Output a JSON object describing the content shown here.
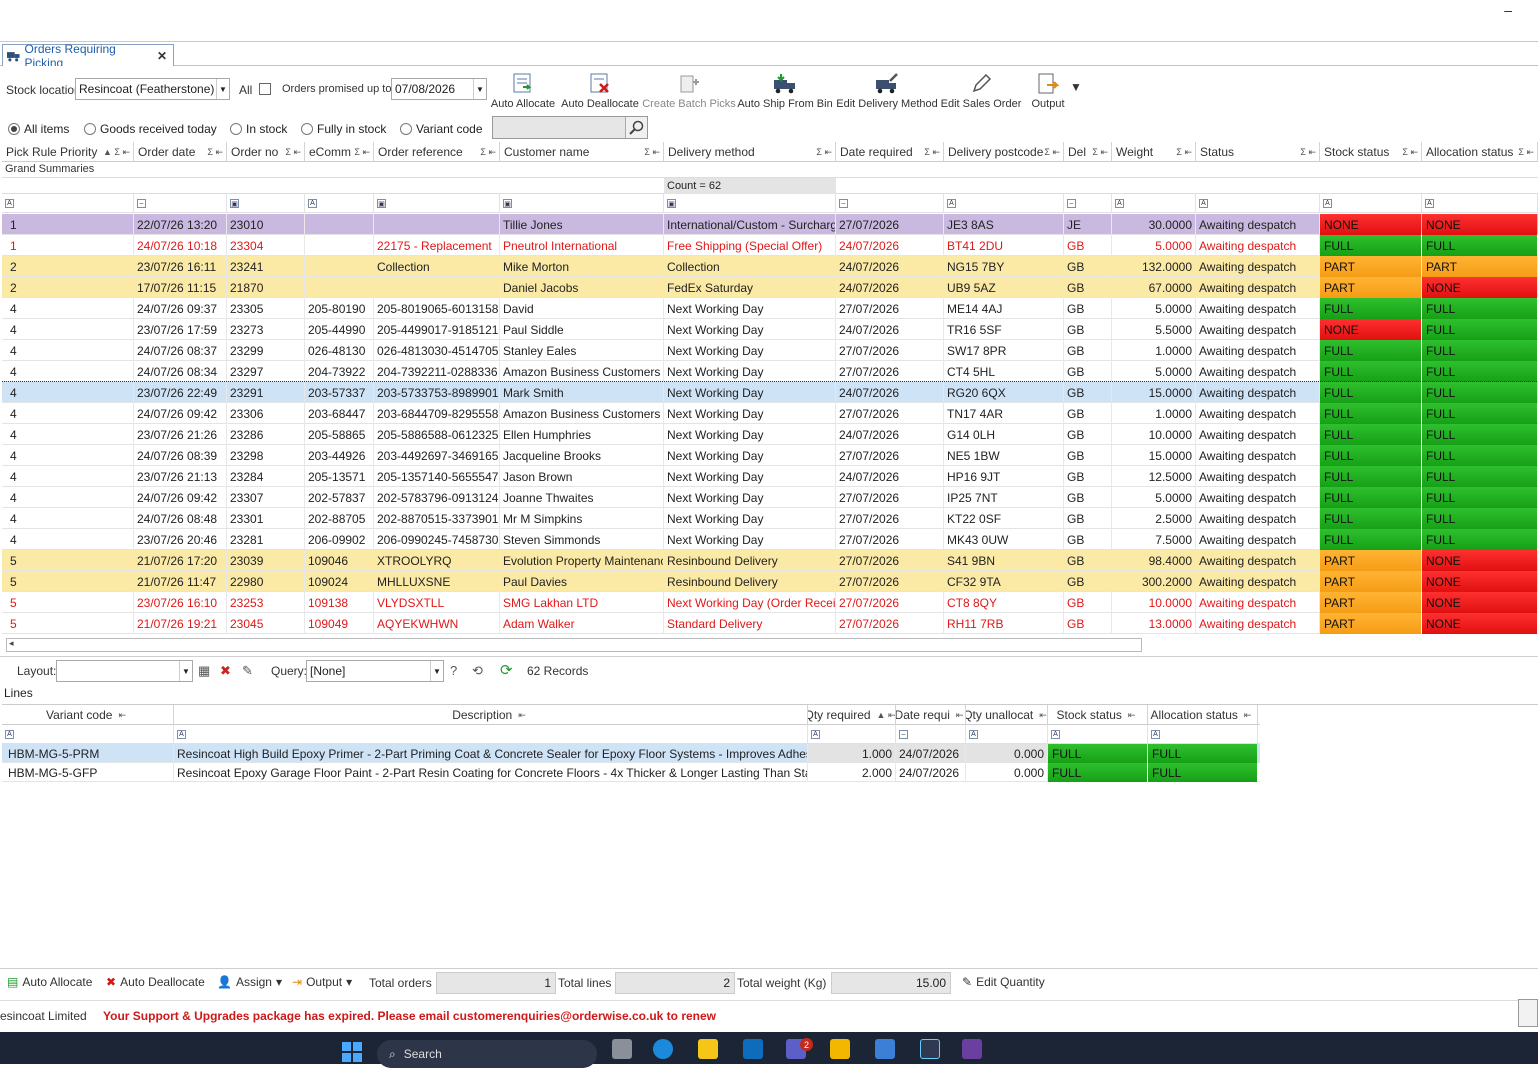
{
  "window": {
    "minimize_symbol": "–"
  },
  "tab": {
    "title": "Orders Requiring Picking",
    "close": "✕"
  },
  "toolbar": {
    "stock_location_label": "Stock location",
    "stock_location_value": "Resincoat (Featherstone)",
    "all_label": "All",
    "promised_label": "Orders promised up to",
    "promised_value": "07/08/2026",
    "buttons": [
      "Auto Allocate",
      "Auto Deallocate",
      "Create Batch Picks",
      "Auto Ship From Bin",
      "Edit Delivery Method",
      "Edit Sales Order",
      "Output"
    ]
  },
  "filters": [
    "All items",
    "Goods received today",
    "In stock",
    "Fully in stock",
    "Variant code"
  ],
  "orders": {
    "columns": [
      "Pick Rule Priority",
      "Order date",
      "Order no",
      "eComm",
      "Order reference",
      "Customer name",
      "Delivery method",
      "Date required",
      "Delivery postcode",
      "Del",
      "Weight",
      "Status",
      "Stock status",
      "Allocation status"
    ],
    "grand_summaries": "Grand Summaries",
    "count_label": "Count = 62",
    "rows": [
      {
        "p": "1",
        "date": "22/07/26 13:20",
        "no": "23010",
        "ec": "",
        "ref": "",
        "cust": "Tillie Jones",
        "dm": "International/Custom - Surcharg",
        "req": "27/07/2026",
        "pc": "JE3 8AS",
        "del": "JE",
        "wt": "30.0000",
        "st": "Awaiting despatch",
        "ss": "NONE",
        "as": "NONE",
        "style": "purple"
      },
      {
        "p": "1",
        "date": "24/07/26 10:18",
        "no": "23304",
        "ec": "",
        "ref": "22175 - Replacement",
        "cust": "Pneutrol International",
        "dm": "Free Shipping (Special Offer)",
        "req": "24/07/2026",
        "pc": "BT41 2DU",
        "del": "GB",
        "wt": "5.0000",
        "st": "Awaiting despatch",
        "ss": "FULL",
        "as": "FULL",
        "style": "red"
      },
      {
        "p": "2",
        "date": "23/07/26 16:11",
        "no": "23241",
        "ec": "",
        "ref": "Collection",
        "cust": "Mike Morton",
        "dm": "Collection",
        "req": "24/07/2026",
        "pc": "NG15 7BY",
        "del": "GB",
        "wt": "132.0000",
        "st": "Awaiting despatch",
        "ss": "PART",
        "as": "PART",
        "style": "yellow"
      },
      {
        "p": "2",
        "date": "17/07/26 11:15",
        "no": "21870",
        "ec": "",
        "ref": "",
        "cust": "Daniel Jacobs",
        "dm": "FedEx Saturday",
        "req": "24/07/2026",
        "pc": "UB9 5AZ",
        "del": "GB",
        "wt": "67.0000",
        "st": "Awaiting despatch",
        "ss": "PART",
        "as": "NONE",
        "style": "yellow"
      },
      {
        "p": "4",
        "date": "24/07/26 09:37",
        "no": "23305",
        "ec": "205-80190",
        "ref": "205-8019065-6013158",
        "cust": "David",
        "dm": "Next Working Day",
        "req": "27/07/2026",
        "pc": "ME14 4AJ",
        "del": "GB",
        "wt": "5.0000",
        "st": "Awaiting despatch",
        "ss": "FULL",
        "as": "FULL",
        "style": ""
      },
      {
        "p": "4",
        "date": "23/07/26 17:59",
        "no": "23273",
        "ec": "205-44990",
        "ref": "205-4499017-9185121",
        "cust": "Paul Siddle",
        "dm": "Next Working Day",
        "req": "24/07/2026",
        "pc": "TR16 5SF",
        "del": "GB",
        "wt": "5.5000",
        "st": "Awaiting despatch",
        "ss": "NONE",
        "as": "FULL",
        "style": ""
      },
      {
        "p": "4",
        "date": "24/07/26 08:37",
        "no": "23299",
        "ec": "026-48130",
        "ref": "026-4813030-4514705",
        "cust": "Stanley Eales",
        "dm": "Next Working Day",
        "req": "27/07/2026",
        "pc": "SW17 8PR",
        "del": "GB",
        "wt": "1.0000",
        "st": "Awaiting despatch",
        "ss": "FULL",
        "as": "FULL",
        "style": ""
      },
      {
        "p": "4",
        "date": "24/07/26 08:34",
        "no": "23297",
        "ec": "204-73922",
        "ref": "204-7392211-0288336",
        "cust": "Amazon Business Customers",
        "dm": "Next Working Day",
        "req": "27/07/2026",
        "pc": "CT4 5HL",
        "del": "GB",
        "wt": "5.0000",
        "st": "Awaiting despatch",
        "ss": "FULL",
        "as": "FULL",
        "style": ""
      },
      {
        "p": "4",
        "date": "23/07/26 22:49",
        "no": "23291",
        "ec": "203-57337",
        "ref": "203-5733753-8989901",
        "cust": "Mark Smith",
        "dm": "Next Working Day",
        "req": "24/07/2026",
        "pc": "RG20 6QX",
        "del": "GB",
        "wt": "15.0000",
        "st": "Awaiting despatch",
        "ss": "FULL",
        "as": "FULL",
        "style": "sel"
      },
      {
        "p": "4",
        "date": "24/07/26 09:42",
        "no": "23306",
        "ec": "203-68447",
        "ref": "203-6844709-8295558",
        "cust": "Amazon Business Customers",
        "dm": "Next Working Day",
        "req": "27/07/2026",
        "pc": "TN17 4AR",
        "del": "GB",
        "wt": "1.0000",
        "st": "Awaiting despatch",
        "ss": "FULL",
        "as": "FULL",
        "style": ""
      },
      {
        "p": "4",
        "date": "23/07/26 21:26",
        "no": "23286",
        "ec": "205-58865",
        "ref": "205-5886588-0612325",
        "cust": "Ellen Humphries",
        "dm": "Next Working Day",
        "req": "24/07/2026",
        "pc": "G14 0LH",
        "del": "GB",
        "wt": "10.0000",
        "st": "Awaiting despatch",
        "ss": "FULL",
        "as": "FULL",
        "style": ""
      },
      {
        "p": "4",
        "date": "24/07/26 08:39",
        "no": "23298",
        "ec": "203-44926",
        "ref": "203-4492697-3469165",
        "cust": "Jacqueline Brooks",
        "dm": "Next Working Day",
        "req": "27/07/2026",
        "pc": "NE5 1BW",
        "del": "GB",
        "wt": "15.0000",
        "st": "Awaiting despatch",
        "ss": "FULL",
        "as": "FULL",
        "style": ""
      },
      {
        "p": "4",
        "date": "23/07/26 21:13",
        "no": "23284",
        "ec": "205-13571",
        "ref": "205-1357140-5655547",
        "cust": "Jason Brown",
        "dm": "Next Working Day",
        "req": "24/07/2026",
        "pc": "HP16 9JT",
        "del": "GB",
        "wt": "12.5000",
        "st": "Awaiting despatch",
        "ss": "FULL",
        "as": "FULL",
        "style": ""
      },
      {
        "p": "4",
        "date": "24/07/26 09:42",
        "no": "23307",
        "ec": "202-57837",
        "ref": "202-5783796-0913124",
        "cust": "Joanne Thwaites",
        "dm": "Next Working Day",
        "req": "27/07/2026",
        "pc": "IP25 7NT",
        "del": "GB",
        "wt": "5.0000",
        "st": "Awaiting despatch",
        "ss": "FULL",
        "as": "FULL",
        "style": ""
      },
      {
        "p": "4",
        "date": "24/07/26 08:48",
        "no": "23301",
        "ec": "202-88705",
        "ref": "202-8870515-3373901",
        "cust": "Mr M Simpkins",
        "dm": "Next Working Day",
        "req": "27/07/2026",
        "pc": "KT22 0SF",
        "del": "GB",
        "wt": "2.5000",
        "st": "Awaiting despatch",
        "ss": "FULL",
        "as": "FULL",
        "style": ""
      },
      {
        "p": "4",
        "date": "23/07/26 20:46",
        "no": "23281",
        "ec": "206-09902",
        "ref": "206-0990245-7458730",
        "cust": "Steven Simmonds",
        "dm": "Next Working Day",
        "req": "27/07/2026",
        "pc": "MK43 0UW",
        "del": "GB",
        "wt": "7.5000",
        "st": "Awaiting despatch",
        "ss": "FULL",
        "as": "FULL",
        "style": ""
      },
      {
        "p": "5",
        "date": "21/07/26 17:20",
        "no": "23039",
        "ec": "109046",
        "ref": "XTROOLYRQ",
        "cust": "Evolution Property Maintenanc",
        "dm": "Resinbound Delivery",
        "req": "27/07/2026",
        "pc": "S41 9BN",
        "del": "GB",
        "wt": "98.4000",
        "st": "Awaiting despatch",
        "ss": "PART",
        "as": "NONE",
        "style": "yellow"
      },
      {
        "p": "5",
        "date": "21/07/26 11:47",
        "no": "22980",
        "ec": "109024",
        "ref": "MHLLUXSNE",
        "cust": "Paul Davies",
        "dm": "Resinbound Delivery",
        "req": "27/07/2026",
        "pc": "CF32 9TA",
        "del": "GB",
        "wt": "300.2000",
        "st": "Awaiting despatch",
        "ss": "PART",
        "as": "NONE",
        "style": "yellow"
      },
      {
        "p": "5",
        "date": "23/07/26 16:10",
        "no": "23253",
        "ec": "109138",
        "ref": "VLYDSXTLL",
        "cust": "SMG Lakhan LTD",
        "dm": "Next Working Day (Order Recei",
        "req": "27/07/2026",
        "pc": "CT8 8QY",
        "del": "GB",
        "wt": "10.0000",
        "st": "Awaiting despatch",
        "ss": "PART",
        "as": "NONE",
        "style": "red"
      },
      {
        "p": "5",
        "date": "21/07/26 19:21",
        "no": "23045",
        "ec": "109049",
        "ref": "AQYEKWHWN",
        "cust": "Adam Walker",
        "dm": "Standard Delivery",
        "req": "27/07/2026",
        "pc": "RH11 7RB",
        "del": "GB",
        "wt": "13.0000",
        "st": "Awaiting despatch",
        "ss": "PART",
        "as": "NONE",
        "style": "red"
      }
    ]
  },
  "grid_toolbar": {
    "layout_label": "Layout:",
    "query_label": "Query:",
    "query_value": "[None]",
    "records": "62 Records"
  },
  "lines": {
    "title": "Lines",
    "columns": [
      "Variant code",
      "Description",
      "Qty required",
      "Date requi",
      "Qty unallocat",
      "Stock status",
      "Allocation status"
    ],
    "rows": [
      {
        "code": "HBM-MG-5-PRM",
        "desc": "Resincoat High Build Epoxy Primer - 2-Part Priming Coat & Concrete Sealer for Epoxy Floor Systems - Improves Adhesion",
        "qty": "1.000",
        "date": "24/07/2026",
        "unal": "0.000",
        "ss": "FULL",
        "as": "FULL",
        "sel": true
      },
      {
        "code": "HBM-MG-5-GFP",
        "desc": "Resincoat Epoxy Garage Floor Paint - 2-Part Resin Coating for Concrete Floors - 4x Thicker & Longer Lasting Than Standar",
        "qty": "2.000",
        "date": "24/07/2026",
        "unal": "0.000",
        "ss": "FULL",
        "as": "FULL",
        "sel": false
      }
    ]
  },
  "statusbar": {
    "auto_allocate": "Auto Allocate",
    "auto_deallocate": "Auto Deallocate",
    "assign": "Assign",
    "output": "Output",
    "total_orders_label": "Total orders",
    "total_orders": "1",
    "total_lines_label": "Total lines",
    "total_lines": "2",
    "total_weight_label": "Total weight (Kg)",
    "total_weight": "15.00",
    "edit_quantity": "Edit Quantity"
  },
  "footer": {
    "company": "esincoat Limited",
    "warning": "Your Support & Upgrades package has expired. Please email customerenquiries@orderwise.co.uk to renew"
  },
  "taskbar": {
    "search": "Search",
    "badge": "2"
  },
  "colors": {
    "full": "#1ea81e",
    "part": "#f7a21e",
    "none": "#ea1a1a",
    "purple_row": "#c9b9e0",
    "yellow_row": "#fbe9a6",
    "selected_row": "#cfe3f7",
    "red_text": "#e01818"
  }
}
